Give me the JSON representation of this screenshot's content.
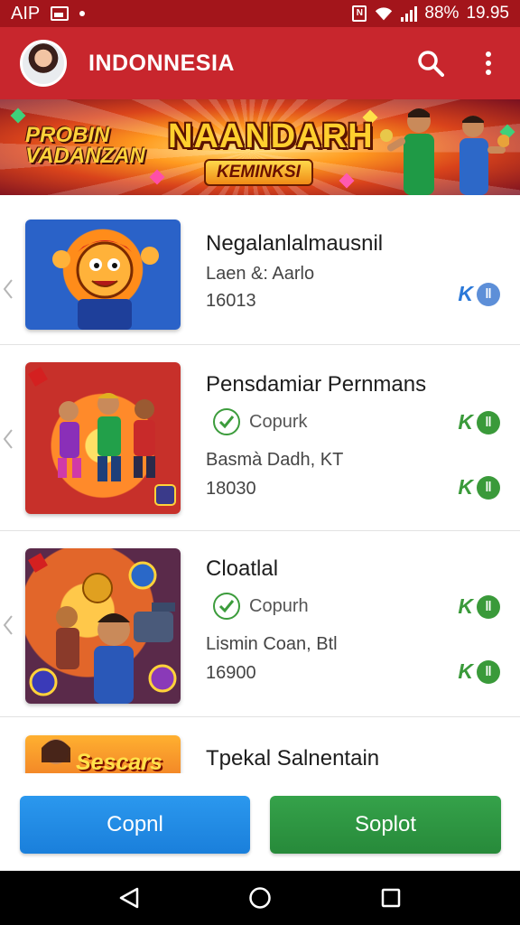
{
  "status_bar": {
    "carrier": "AIP",
    "battery": "88%",
    "time": "19.95"
  },
  "app_bar": {
    "title": "INDONNESIA",
    "icons": [
      "avatar",
      "search-icon",
      "more-vert-icon"
    ]
  },
  "banner": {
    "subtitle": "PROBIN VADANZAN",
    "title": "NAANDARH",
    "tag": "KEMINKSI"
  },
  "items": [
    {
      "title": "Negalanlalmausnil",
      "line1": "Laen &: Aarlo",
      "line2": "16013",
      "badge_color": "#2a78d8"
    },
    {
      "title": "Pensdamiar Pernmans",
      "status": "Copurk",
      "line1": "Basmà Dadh, KT",
      "line2": "18030",
      "badge_color": "#3a9a3a"
    },
    {
      "title": "Cloatlal",
      "status": "Copurh",
      "line1": "Lismin Coan, Btl",
      "line2": "16900",
      "badge_color": "#3a9a3a"
    },
    {
      "title": "Tpekal Salnentain",
      "thumb_text": "Sescars"
    }
  ],
  "buttons": {
    "primary": "Copnl",
    "secondary": "Soplot"
  },
  "colors": {
    "status_bar": "#a3151b",
    "app_bar": "#c8262d",
    "button_blue": "#1f88e5",
    "button_green": "#2e9541"
  }
}
